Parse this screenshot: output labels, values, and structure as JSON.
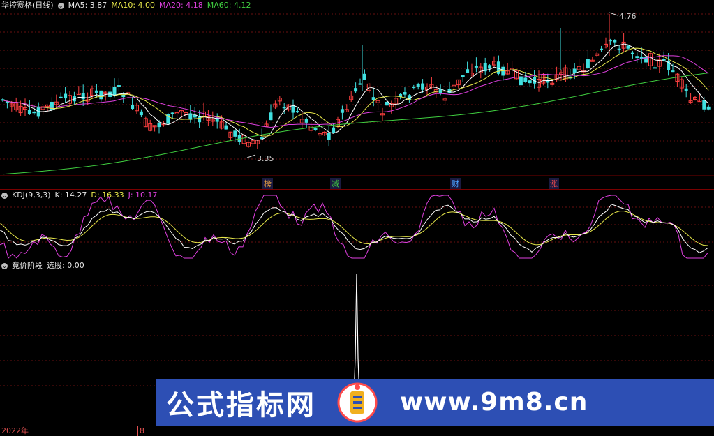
{
  "main": {
    "name": "华控赛格(日线)",
    "ma5_label": "MA5: 3.87",
    "ma10_label": "MA10: 4.00",
    "ma20_label": "MA20: 4.18",
    "ma60_label": "MA60: 4.12",
    "high_mark": "4.76",
    "low_mark": "3.35",
    "tags": [
      "榜",
      "减",
      "财",
      "涨"
    ],
    "colors": {
      "up": "#ff4040",
      "down": "#40e0e0",
      "ma5": "#ffffff",
      "ma10": "#e8e84a",
      "ma20": "#e040e0",
      "ma60": "#40d040"
    }
  },
  "kdj": {
    "title": "KDJ(9,3,3)",
    "k_label": "K: 14.27",
    "d_label": "D: 16.33",
    "j_label": "J: 10.17"
  },
  "jj": {
    "title": "竟价阶段",
    "select_label": "选股: 0.00"
  },
  "bottom": {
    "year": "2022年",
    "month": "8"
  },
  "watermark": {
    "title": "公式指标网",
    "url": "www.9m8.cn",
    "logo_text": "www.9m8.cn"
  },
  "icons": {
    "collapse": "circle-chevron-icon"
  }
}
